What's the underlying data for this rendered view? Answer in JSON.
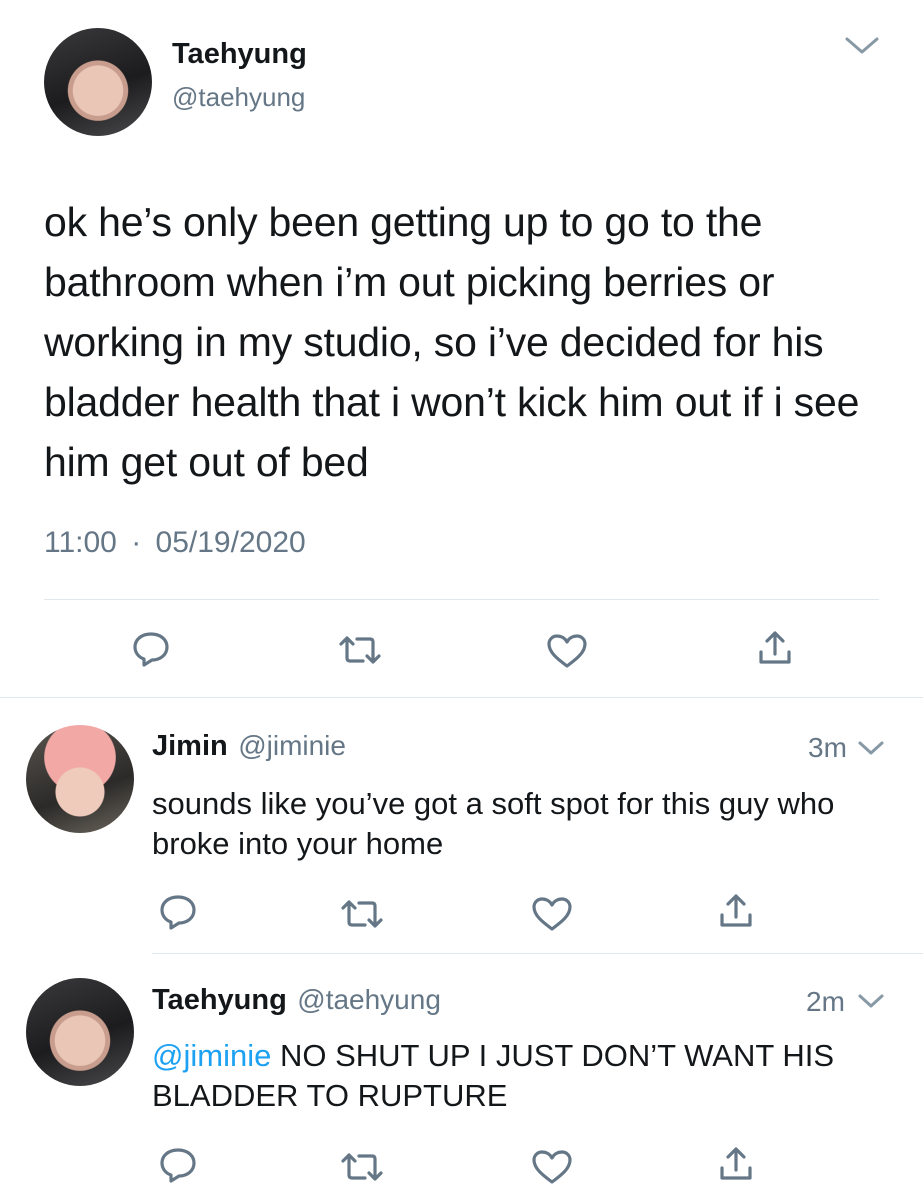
{
  "main_tweet": {
    "name": "Taehyung",
    "handle": "@taehyung",
    "text": "ok he’s only been getting up to go to the bathroom when i’m out picking berries or working in my studio, so i’ve decided for his bladder health that i won’t kick him out if i see him get out of bed",
    "time": "11:00",
    "separator": "·",
    "date": "05/19/2020"
  },
  "replies": [
    {
      "name": "Jimin",
      "handle": "@jiminie",
      "age": "3m",
      "text": "sounds like you’ve got a soft spot for this guy who broke into your home"
    },
    {
      "name": "Taehyung",
      "handle": "@taehyung",
      "age": "2m",
      "mention": "@jiminie",
      "text": "NO SHUT UP I JUST DON’T WANT HIS BLADDER TO RUPTURE"
    }
  ],
  "icons": [
    "reply-icon",
    "retweet-icon",
    "like-icon",
    "share-icon",
    "chevron-down-icon"
  ],
  "colors": {
    "text": "#14171a",
    "secondary": "#657786",
    "divider": "#e1e8ed",
    "link": "#1da1f2"
  }
}
